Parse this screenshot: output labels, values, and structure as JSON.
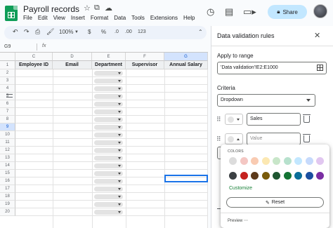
{
  "doc": {
    "title": "Payroll records"
  },
  "menu": [
    "File",
    "Edit",
    "View",
    "Insert",
    "Format",
    "Data",
    "Tools",
    "Extensions",
    "Help"
  ],
  "header": {
    "share_label": "Share"
  },
  "toolbar": {
    "zoom": "100%",
    "currency": "$",
    "percent": "%",
    "dec_less": ".0",
    "dec_more": ".00",
    "number_format": "123"
  },
  "formula_bar": {
    "cell_ref": "G9",
    "fx": "fx",
    "value": ""
  },
  "grid": {
    "columns": [
      "C",
      "D",
      "E",
      "F",
      "G"
    ],
    "selected_column": "G",
    "selected_row": "9",
    "rows": [
      "1",
      "2",
      "3",
      "4",
      "5",
      "6",
      "7",
      "8",
      "9",
      "10",
      "11",
      "12",
      "13",
      "14",
      "15",
      "16",
      "17",
      "18",
      "19",
      "20"
    ],
    "headers": [
      "Employee ID",
      "Email",
      "Department",
      "Supervisor",
      "Annual Salary"
    ]
  },
  "panel": {
    "title": "Data validation rules",
    "apply_label": "Apply to range",
    "range_value": "'Data validation'!E2:E1000",
    "criteria_label": "Criteria",
    "criteria_value": "Dropdown",
    "options": [
      {
        "value": "Sales",
        "placeholder": ""
      },
      {
        "value": "",
        "placeholder": "Value"
      }
    ]
  },
  "color_popover": {
    "title": "COLORS",
    "light_colors": [
      "#dcdcdc",
      "#f4c7c3",
      "#f9cbb2",
      "#fce8b2",
      "#c8e6c9",
      "#b7e1cd",
      "#c2e7ff",
      "#c6dafc",
      "#e1c7f0"
    ],
    "dark_colors": [
      "#3c4043",
      "#c5221f",
      "#5d3a1a",
      "#7a5b0a",
      "#1e5631",
      "#137333",
      "#0b6e99",
      "#1a4fa0",
      "#7b2ea3"
    ],
    "customize_label": "Customize",
    "reset_label": "Reset",
    "preview_label": "Preview"
  }
}
